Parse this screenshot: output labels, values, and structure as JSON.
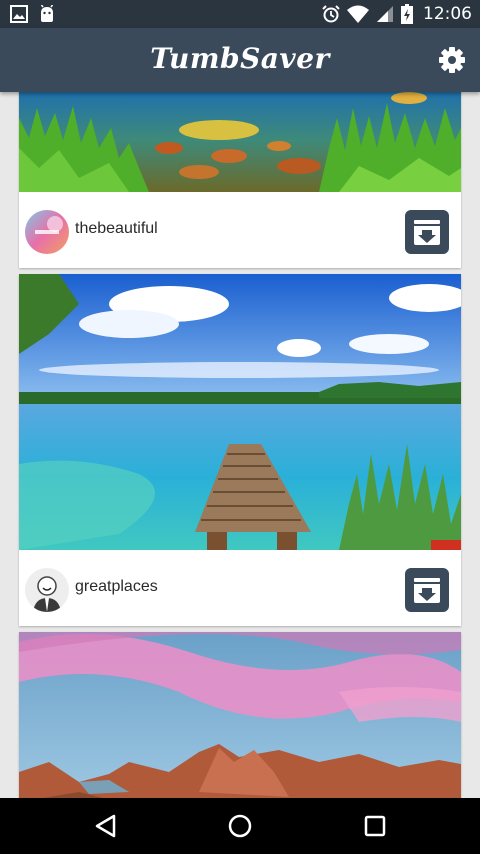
{
  "status_bar": {
    "time": "12:06",
    "left_icons": [
      "image-notification-icon",
      "android-notification-icon"
    ],
    "right_icons": [
      "alarm-icon",
      "wifi-icon",
      "cell-signal-icon",
      "battery-charging-icon"
    ]
  },
  "app_bar": {
    "title": "TumbSaver",
    "settings_icon": "gear-icon"
  },
  "feed": {
    "posts": [
      {
        "username": "thebeautiful",
        "image": "lake-shore-grass-photo"
      },
      {
        "username": "greatplaces",
        "image": "lake-pier-photo"
      },
      {
        "username": "",
        "image": "pink-sky-canyon-photo"
      }
    ]
  },
  "nav_bar": {
    "buttons": [
      "back-icon",
      "home-icon",
      "recents-icon"
    ]
  },
  "colors": {
    "status_bar": "#2b3540",
    "app_bar": "#3a4a5a",
    "download_button": "#3a4a5a",
    "background": "#e8e8e8"
  }
}
